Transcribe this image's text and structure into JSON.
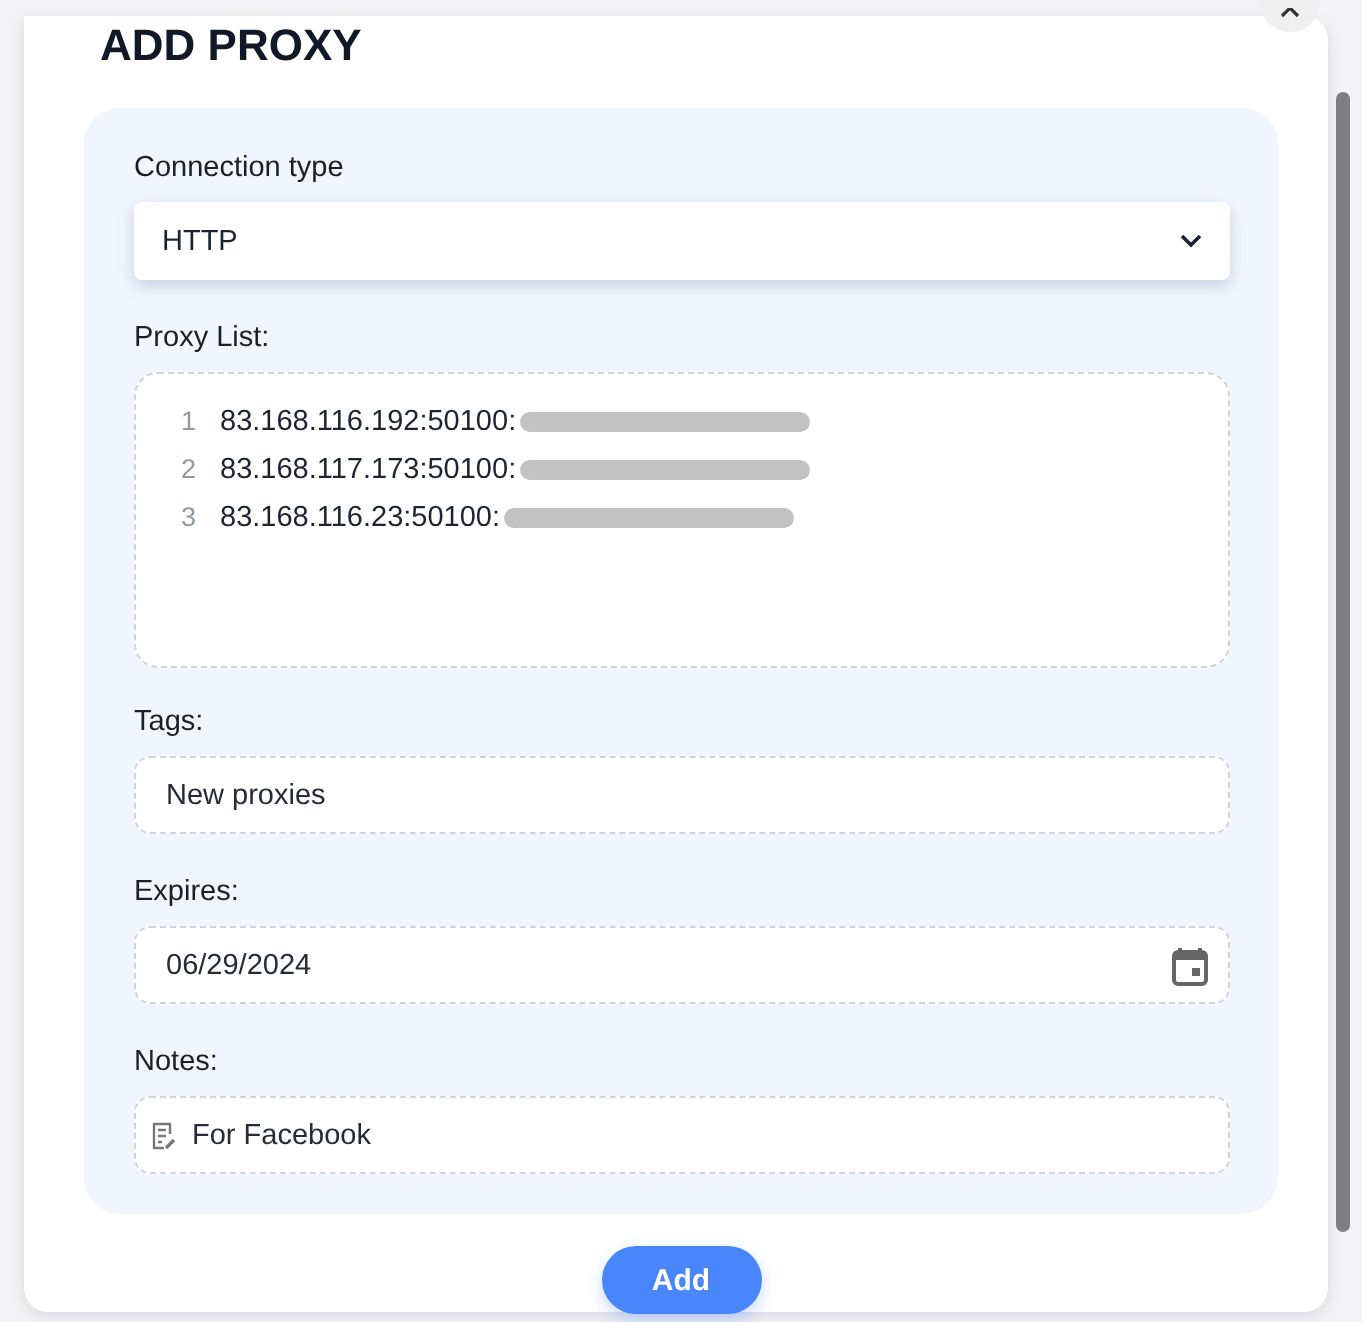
{
  "dialog": {
    "title": "ADD PROXY"
  },
  "connection_type": {
    "label": "Connection type",
    "value": "HTTP"
  },
  "proxy_list": {
    "label": "Proxy List:",
    "lines": [
      {
        "number": "1",
        "text": "83.168.116.192:50100:",
        "redacted": true
      },
      {
        "number": "2",
        "text": "83.168.117.173:50100:",
        "redacted": true
      },
      {
        "number": "3",
        "text": "83.168.116.23:50100:",
        "redacted": true
      }
    ]
  },
  "tags": {
    "label": "Tags:",
    "value": "New proxies"
  },
  "expires": {
    "label": "Expires:",
    "value": "06/29/2024"
  },
  "notes": {
    "label": "Notes:",
    "value": "For Facebook"
  },
  "buttons": [
    {
      "label": "Add"
    }
  ]
}
